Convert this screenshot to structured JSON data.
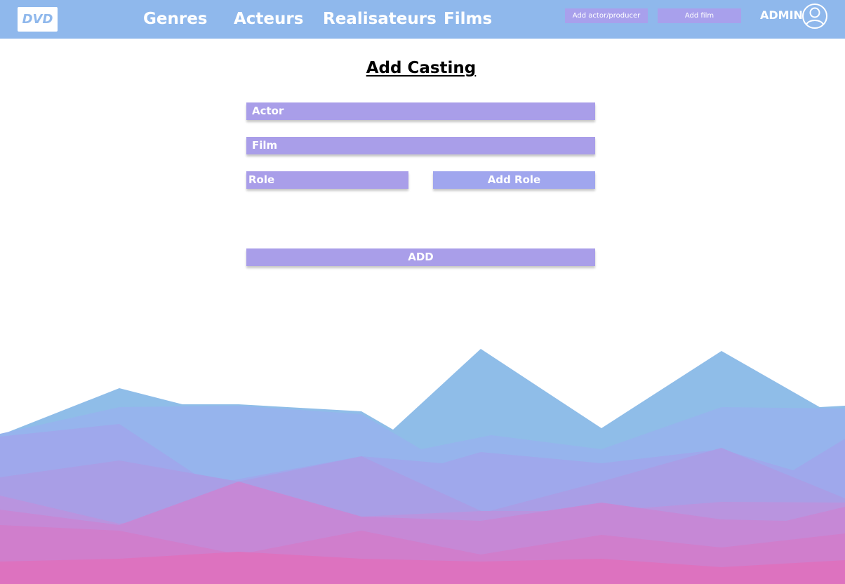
{
  "logo": {
    "text": "DVD"
  },
  "nav": {
    "links": [
      {
        "label": "Genres"
      },
      {
        "label": "Acteurs"
      },
      {
        "label": "Realisateurs"
      },
      {
        "label": "Films"
      }
    ],
    "add_actor_producer_label": "Add actor/producer",
    "add_film_label": "Add film",
    "admin_label": "ADMIN",
    "avatar_icon": "user-circle-icon"
  },
  "page": {
    "title": "Add Casting"
  },
  "form": {
    "actor_label": "Actor",
    "film_label": "Film",
    "role_label": "Role",
    "add_role_label": "Add Role",
    "add_label": "ADD"
  },
  "colors": {
    "navbar": "#8fb8ec",
    "field": "#a99ee9",
    "button": "#a0a6ee",
    "mountain_blue": "#8fbde8",
    "mountain_pink": "#dd70be"
  }
}
